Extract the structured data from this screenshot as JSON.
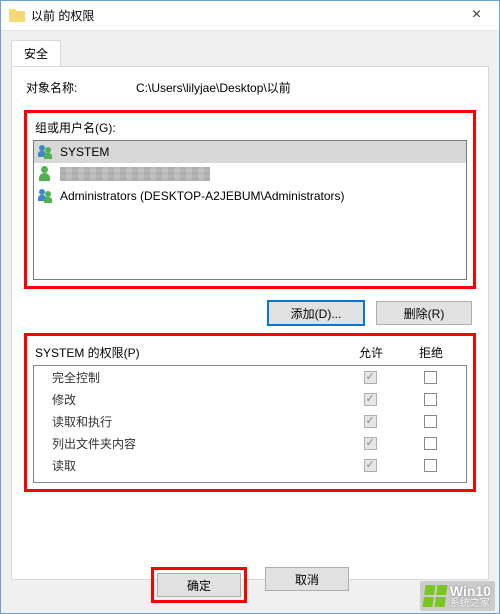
{
  "window": {
    "title": "以前 的权限",
    "close_glyph": "×"
  },
  "tab": {
    "label": "安全"
  },
  "object": {
    "label": "对象名称:",
    "value": "C:\\Users\\lilyjae\\Desktop\\以前"
  },
  "groups": {
    "label": "组或用户名(G):",
    "items": [
      {
        "name": "SYSTEM",
        "icon": "two",
        "selected": true,
        "obscured": false
      },
      {
        "name": "",
        "icon": "one",
        "selected": false,
        "obscured": true
      },
      {
        "name": "Administrators (DESKTOP-A2JEBUM\\Administrators)",
        "icon": "two",
        "selected": false,
        "obscured": false
      }
    ]
  },
  "buttons": {
    "add": "添加(D)...",
    "remove": "删除(R)",
    "ok": "确定",
    "cancel": "取消"
  },
  "permissions": {
    "header_label": "SYSTEM 的权限(P)",
    "col_allow": "允许",
    "col_deny": "拒绝",
    "rows": [
      {
        "name": "完全控制",
        "allow": true,
        "deny": false
      },
      {
        "name": "修改",
        "allow": true,
        "deny": false
      },
      {
        "name": "读取和执行",
        "allow": true,
        "deny": false
      },
      {
        "name": "列出文件夹内容",
        "allow": true,
        "deny": false
      },
      {
        "name": "读取",
        "allow": true,
        "deny": false
      }
    ]
  },
  "watermark": {
    "line1": "Win10",
    "line2": "系统之家"
  }
}
